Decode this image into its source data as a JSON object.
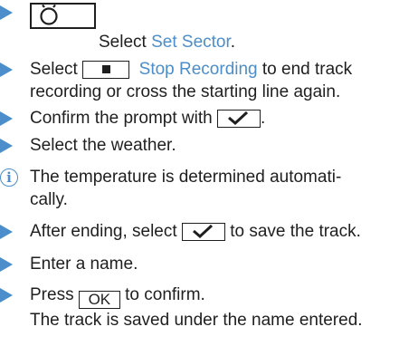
{
  "colors": {
    "accent": "#4b8ecb",
    "text": "#1f1f1f"
  },
  "steps": {
    "s1": {
      "text": "Select ",
      "link": "Set Sector",
      "after": ".",
      "icon": "sector-stopwatch-icon"
    },
    "s2": {
      "pre": "Select ",
      "link": "Stop Recording",
      "line1_after": " to end track",
      "line2": "recording or cross the starting line again.",
      "icon": "stop-square-icon"
    },
    "s3": {
      "text": "Confirm the prompt with ",
      "after": ".",
      "icon": "checkmark-icon"
    },
    "s4": {
      "text": "Select the weather."
    },
    "note": {
      "line1": "The temperature is determined automati-",
      "line2": "cally.",
      "icon": "info-icon"
    },
    "s5": {
      "pre": "After ending, select ",
      "after": " to save the track.",
      "icon": "checkmark-icon"
    },
    "s6": {
      "text": "Enter a name."
    },
    "s7": {
      "pre": "Press ",
      "button": "OK",
      "after": " to confirm.",
      "result": "The track is saved under the name entered."
    }
  }
}
